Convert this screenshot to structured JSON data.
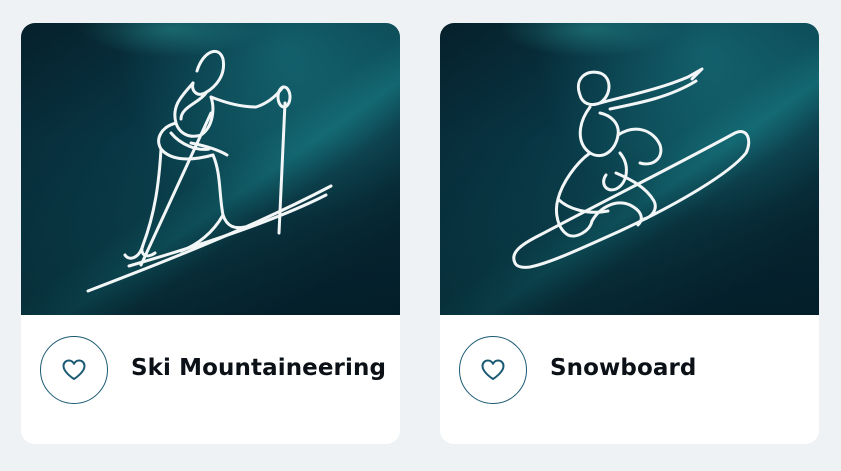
{
  "cards": [
    {
      "title": "Ski Mountaineering",
      "illustration": "ski-mountaineer-line-art",
      "favorite_icon": "heart-outline-icon"
    },
    {
      "title": "Snowboard",
      "illustration": "snowboarder-line-art",
      "favorite_icon": "heart-outline-icon"
    }
  ],
  "colors": {
    "page_background": "#eef2f5",
    "card_background": "#ffffff",
    "image_dark": "#06202b",
    "image_teal": "#11616b",
    "line_art": "#f2f6f7",
    "accent": "#1b5a73",
    "title_text": "#0b1116"
  }
}
